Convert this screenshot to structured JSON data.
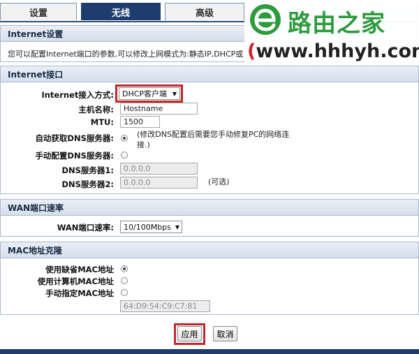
{
  "tabs": [
    "设置",
    "无线",
    "高级",
    "",
    ""
  ],
  "internet_settings": {
    "title": "Internet设置",
    "description": "您可以配置Internet端口的参数,可以修改上网模式为:静态IP,DHCP或"
  },
  "internet_port": {
    "title": "Internet接口",
    "access_mode_label": "Internet接入方式:",
    "access_mode_value": "DHCP客户端",
    "hostname_label": "主机名称:",
    "hostname_value": "Hostname",
    "mtu_label": "MTU:",
    "mtu_value": "1500",
    "auto_dns_label": "自动获取DNS服务器:",
    "auto_dns_note": "(修改DNS配置后需要您手动修复PC的网络连接.)",
    "manual_dns_label": "手动配置DNS服务器:",
    "dns1_label": "DNS服务器1:",
    "dns1_value": "0.0.0.0",
    "dns2_label": "DNS服务器2:",
    "dns2_value": "0.0.0.0",
    "dns2_optional": "(可选)"
  },
  "wan_speed": {
    "title": "WAN端口速率",
    "label": "WAN端口速率:",
    "value": "10/100Mbps"
  },
  "mac_clone": {
    "title": "MAC地址克隆",
    "default_label": "使用缺省MAC地址",
    "computer_label": "使用计算机MAC地址",
    "manual_label": "手动指定MAC地址",
    "mac_value": "64:D9:54:C9:C7:81"
  },
  "buttons": {
    "apply": "应用",
    "cancel": "取消"
  },
  "watermark": {
    "title": "路由之家",
    "url": "www.hhhyh.com"
  },
  "colors": {
    "nav_active": "#1e3d6e",
    "highlight": "#c0282d",
    "logo_green": "#2e9a3e"
  }
}
